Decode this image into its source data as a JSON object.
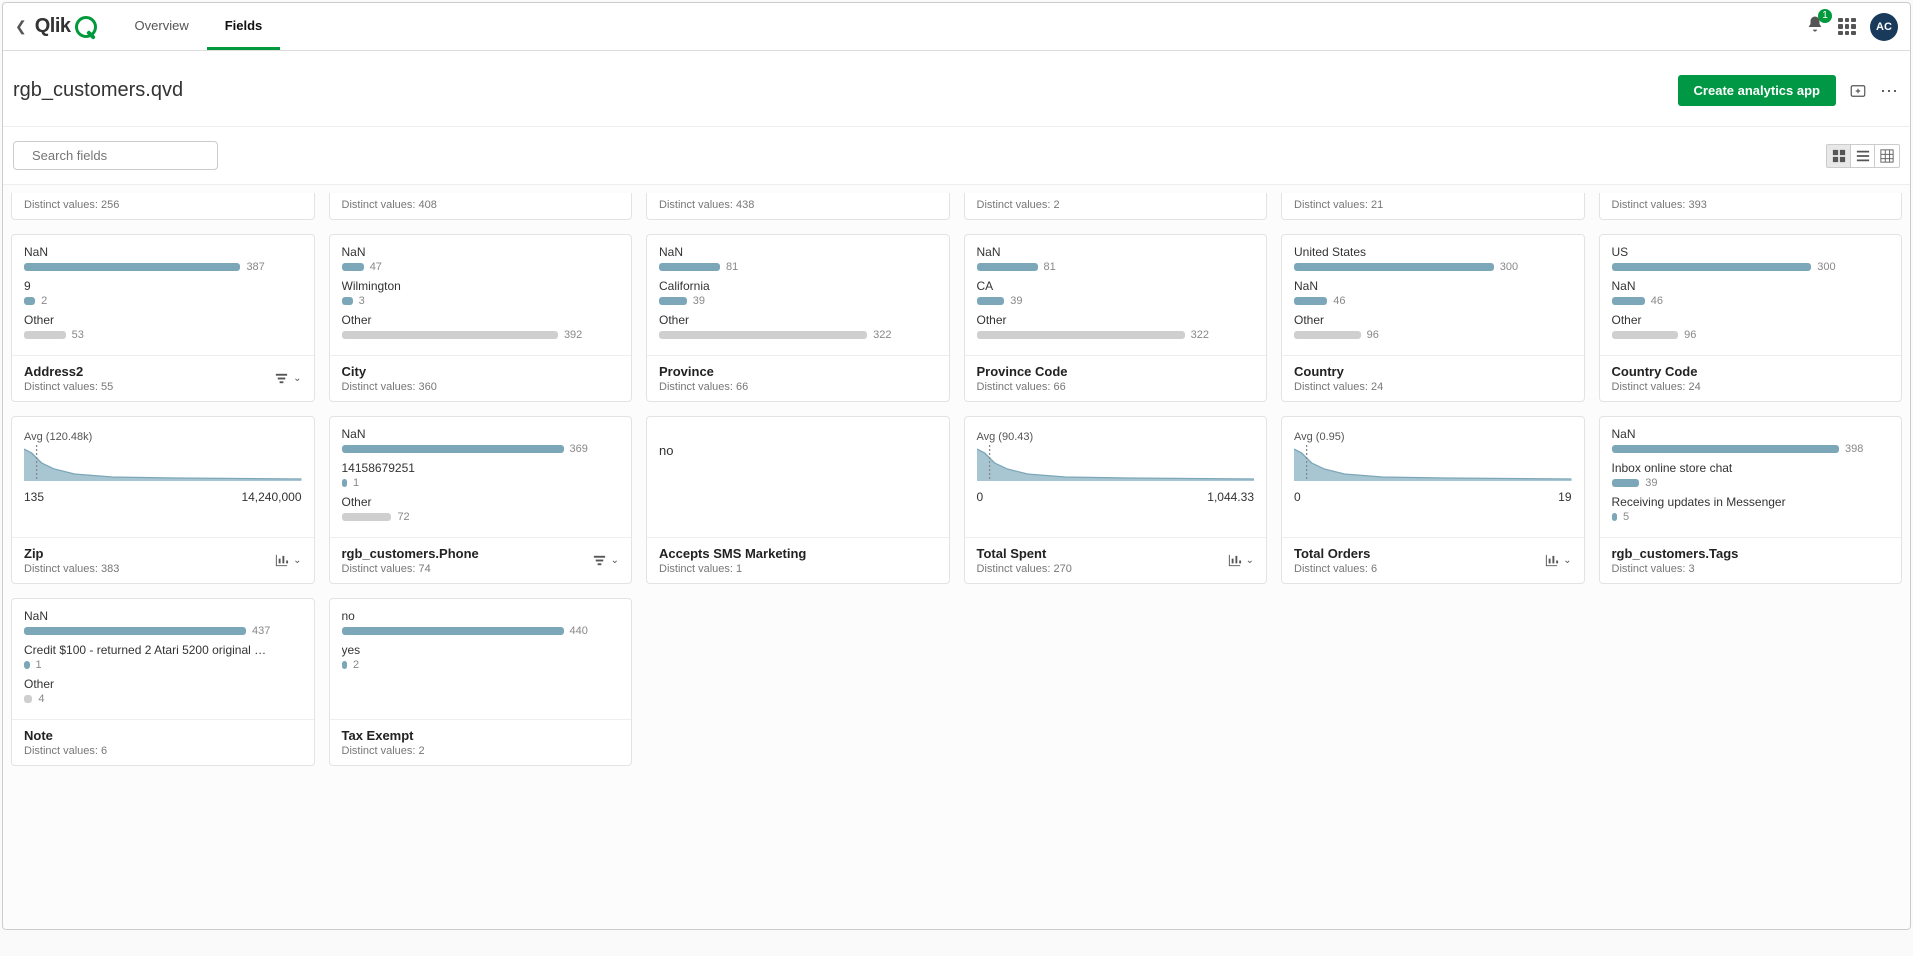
{
  "header": {
    "tabs": {
      "overview": "Overview",
      "fields": "Fields"
    },
    "notification_count": "1",
    "avatar_initials": "AC"
  },
  "title": {
    "filename": "rgb_customers.qvd",
    "create_btn": "Create analytics app"
  },
  "controls": {
    "search_placeholder": "Search fields"
  },
  "partial_row": [
    {
      "distinct": "Distinct values: 256"
    },
    {
      "distinct": "Distinct values: 408"
    },
    {
      "distinct": "Distinct values: 438"
    },
    {
      "distinct": "Distinct values: 2"
    },
    {
      "distinct": "Distinct values: 21"
    },
    {
      "distinct": "Distinct values: 393"
    }
  ],
  "cards": [
    {
      "type": "dist",
      "rows": [
        {
          "label": "NaN",
          "bar": 78,
          "color": "blue",
          "count": "387"
        },
        {
          "label": "9",
          "bar": 4,
          "color": "blue",
          "count": "2"
        },
        {
          "label": "Other",
          "bar": 15,
          "color": "grey",
          "count": "53"
        }
      ],
      "name": "Address2",
      "distinct": "Distinct values: 55",
      "foot_icon": "filter"
    },
    {
      "type": "dist",
      "rows": [
        {
          "label": "NaN",
          "bar": 8,
          "color": "blue",
          "count": "47"
        },
        {
          "label": "Wilmington",
          "bar": 4,
          "color": "blue",
          "count": "3"
        },
        {
          "label": "Other",
          "bar": 78,
          "color": "grey",
          "count": "392"
        }
      ],
      "name": "City",
      "distinct": "Distinct values: 360"
    },
    {
      "type": "dist",
      "rows": [
        {
          "label": "NaN",
          "bar": 22,
          "color": "blue",
          "count": "81"
        },
        {
          "label": "California",
          "bar": 10,
          "color": "blue",
          "count": "39"
        },
        {
          "label": "Other",
          "bar": 75,
          "color": "grey",
          "count": "322"
        }
      ],
      "name": "Province",
      "distinct": "Distinct values: 66"
    },
    {
      "type": "dist",
      "rows": [
        {
          "label": "NaN",
          "bar": 22,
          "color": "blue",
          "count": "81"
        },
        {
          "label": "CA",
          "bar": 10,
          "color": "blue",
          "count": "39"
        },
        {
          "label": "Other",
          "bar": 75,
          "color": "grey",
          "count": "322"
        }
      ],
      "name": "Province Code",
      "distinct": "Distinct values: 66"
    },
    {
      "type": "dist",
      "rows": [
        {
          "label": "United States",
          "bar": 72,
          "color": "blue",
          "count": "300"
        },
        {
          "label": "NaN",
          "bar": 12,
          "color": "blue",
          "count": "46"
        },
        {
          "label": "Other",
          "bar": 24,
          "color": "grey",
          "count": "96"
        }
      ],
      "name": "Country",
      "distinct": "Distinct values: 24"
    },
    {
      "type": "dist",
      "rows": [
        {
          "label": "US",
          "bar": 72,
          "color": "blue",
          "count": "300"
        },
        {
          "label": "NaN",
          "bar": 12,
          "color": "blue",
          "count": "46"
        },
        {
          "label": "Other",
          "bar": 24,
          "color": "grey",
          "count": "96"
        }
      ],
      "name": "Country Code",
      "distinct": "Distinct values: 24"
    },
    {
      "type": "spark",
      "avg": "Avg (120.48k)",
      "min": "135",
      "max": "14,240,000",
      "name": "Zip",
      "distinct": "Distinct values: 383",
      "foot_icon": "chart"
    },
    {
      "type": "dist",
      "rows": [
        {
          "label": "NaN",
          "bar": 80,
          "color": "blue",
          "count": "369"
        },
        {
          "label": "14158679251",
          "bar": 2,
          "color": "blue",
          "count": "1"
        },
        {
          "label": "Other",
          "bar": 18,
          "color": "grey",
          "count": "72"
        }
      ],
      "name": "rgb_customers.Phone",
      "distinct": "Distinct values: 74",
      "foot_icon": "filter"
    },
    {
      "type": "single",
      "value": "no",
      "name": "Accepts SMS Marketing",
      "distinct": "Distinct values: 1"
    },
    {
      "type": "spark",
      "avg": "Avg (90.43)",
      "min": "0",
      "max": "1,044.33",
      "name": "Total Spent",
      "distinct": "Distinct values: 270",
      "foot_icon": "chart"
    },
    {
      "type": "spark",
      "avg": "Avg (0.95)",
      "min": "0",
      "max": "19",
      "name": "Total Orders",
      "distinct": "Distinct values: 6",
      "foot_icon": "chart"
    },
    {
      "type": "dist",
      "rows": [
        {
          "label": "NaN",
          "bar": 82,
          "color": "blue",
          "count": "398"
        },
        {
          "label": "Inbox online store chat",
          "bar": 10,
          "color": "blue",
          "count": "39"
        },
        {
          "label": "Receiving updates in Messenger",
          "bar": 2,
          "color": "blue",
          "count": "5"
        }
      ],
      "name": "rgb_customers.Tags",
      "distinct": "Distinct values: 3"
    },
    {
      "type": "dist",
      "rows": [
        {
          "label": "NaN",
          "bar": 80,
          "color": "blue",
          "count": "437"
        },
        {
          "label": "Credit $100 - returned 2 Atari 5200 original …",
          "bar": 2,
          "color": "blue",
          "count": "1"
        },
        {
          "label": "Other",
          "bar": 3,
          "color": "grey",
          "count": "4"
        }
      ],
      "name": "Note",
      "distinct": "Distinct values: 6"
    },
    {
      "type": "dist",
      "rows": [
        {
          "label": "no",
          "bar": 80,
          "color": "blue",
          "count": "440"
        },
        {
          "label": "yes",
          "bar": 2,
          "color": "blue",
          "count": "2"
        }
      ],
      "name": "Tax Exempt",
      "distinct": "Distinct values: 2"
    }
  ]
}
